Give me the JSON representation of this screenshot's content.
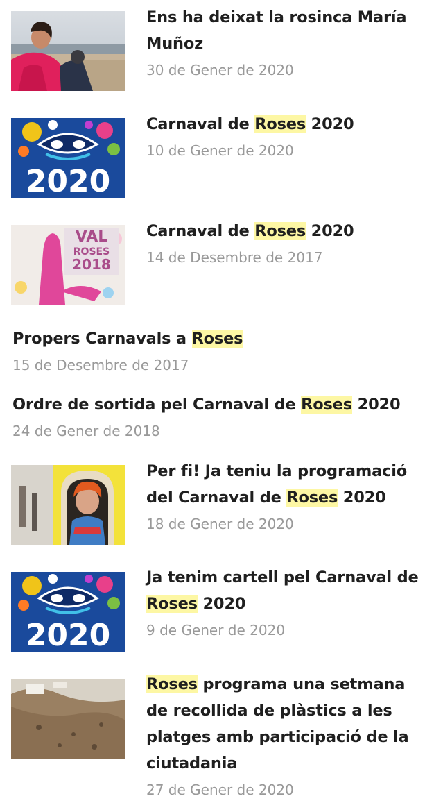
{
  "colors": {
    "title": "#1f1f1f",
    "date": "#999999",
    "highlight": "#fdf7a4"
  },
  "articles": [
    {
      "thumb": "woman-beach-photo",
      "parts": [
        "Ens ha deixat la rosinca María Muñoz"
      ],
      "date": "30 de Gener de 2020"
    },
    {
      "thumb": "carnaval-2020-poster",
      "parts": [
        "Carnaval de ",
        "Roses",
        " 2020"
      ],
      "date": "10 de Gener de 2020"
    },
    {
      "thumb": "carnaval-roses-2018-poster",
      "parts": [
        "Carnaval de ",
        "Roses",
        " 2020"
      ],
      "date": "14 de Desembre de 2017"
    },
    {
      "thumb": null,
      "parts": [
        "Propers Carnavals a ",
        "Roses"
      ],
      "date": "15 de Desembre de 2017"
    },
    {
      "thumb": null,
      "parts": [
        "Ordre de sortida pel Carnaval de ",
        "Roses",
        " 2020"
      ],
      "date": "24 de Gener de 2018"
    },
    {
      "thumb": "costumed-person-photo",
      "parts": [
        "Per fi! Ja teniu la programació del Carnaval de ",
        "Roses",
        " 2020"
      ],
      "date": "18 de Gener de 2020"
    },
    {
      "thumb": "carnaval-2020-poster",
      "parts": [
        "Ja tenim cartell pel Carnaval de ",
        "Roses",
        " 2020"
      ],
      "date": "9 de Gener de 2020"
    },
    {
      "thumb": "beach-aerial-photo",
      "parts": [
        "Roses",
        " programa una setmana de recollida de plàstics a les platges amb participació de la ciutadania"
      ],
      "date": "27 de Gener de 2020"
    }
  ]
}
